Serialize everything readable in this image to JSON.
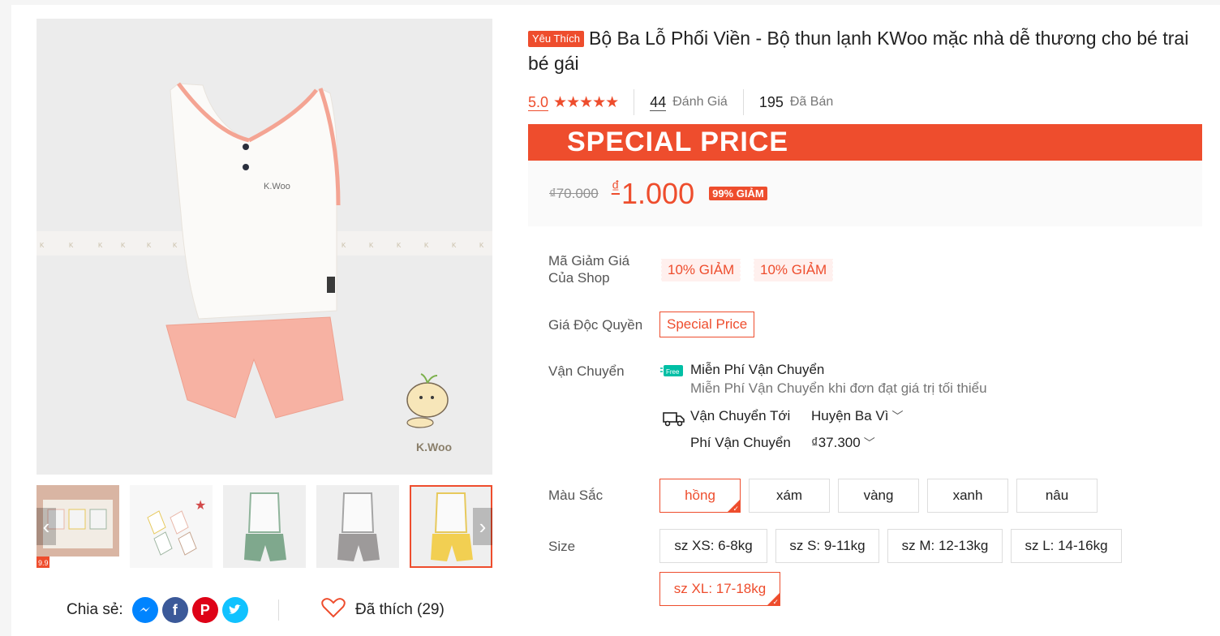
{
  "product": {
    "badge": "Yêu Thích",
    "title": "Bộ Ba Lỗ Phối Viền - Bộ thun lạnh KWoo mặc nhà dễ thương cho bé trai bé gái",
    "rating": "5.0",
    "stars": "★★★★★",
    "reviews_count": "44",
    "reviews_label": "Đánh Giá",
    "sold_count": "195",
    "sold_label": "Đã Bán",
    "image_watermark": "K.Woo",
    "image_tag": "K.Woo"
  },
  "promo": {
    "banner": "SPECIAL PRICE",
    "old_price": "₫70.000",
    "currency": "₫",
    "price": "1.000",
    "discount": "99% GIẢM"
  },
  "vouchers": {
    "label": "Mã Giảm Giá Của Shop",
    "items": [
      "10% GIẢM",
      "10% GIẢM"
    ]
  },
  "exclusive": {
    "label": "Giá Độc Quyền",
    "value": "Special Price"
  },
  "shipping": {
    "label": "Vận Chuyển",
    "free_badge": "Free",
    "free_title": "Miễn Phí Vận Chuyển",
    "free_sub": "Miễn Phí Vận Chuyển khi đơn đạt giá trị tối thiểu",
    "to_label": "Vận Chuyển Tới",
    "to_value": "Huyện Ba Vì",
    "fee_label": "Phí Vận Chuyển",
    "fee_value": "₫37.300"
  },
  "colors": {
    "label": "Màu Sắc",
    "options": [
      "hồng",
      "xám",
      "vàng",
      "xanh",
      "nâu"
    ],
    "selected": "hồng"
  },
  "sizes": {
    "label": "Size",
    "options": [
      "sz XS: 6-8kg",
      "sz S: 9-11kg",
      "sz M: 12-13kg",
      "sz L: 14-16kg",
      "sz XL: 17-18kg"
    ],
    "selected": "sz XL: 17-18kg"
  },
  "thumbnail_badge": "9.9",
  "share": {
    "label": "Chia sẻ:",
    "networks": [
      "messenger-icon",
      "facebook-icon",
      "pinterest-icon",
      "twitter-icon"
    ]
  },
  "likes": {
    "label": "Đã thích (29)"
  },
  "theme": {
    "accent": "#ee4d2d",
    "accent_light": "#fff0ee",
    "shorts_pink": "#f7b2a3",
    "trim_pink": "#f4a493"
  }
}
